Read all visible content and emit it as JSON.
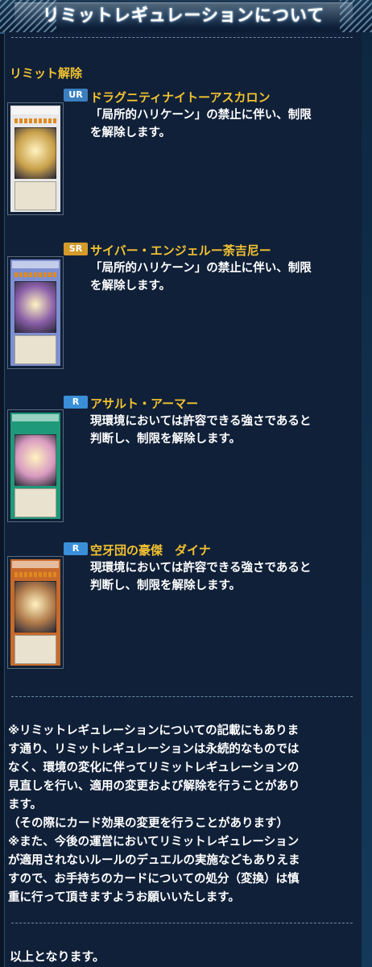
{
  "header": {
    "title": "リミットレギュレーションについて"
  },
  "section": {
    "title": "リミット解除"
  },
  "cards": [
    {
      "rarity": "UR",
      "rarity_color": "#3a7fbf",
      "name": "ドラグニティナイトーアスカロン",
      "desc_line1": "「局所的ハリケーン」の禁止に伴い、制限",
      "desc_line2": "を解除します。",
      "frame_color": "#e8e8ea",
      "art_color": "#c9a04a"
    },
    {
      "rarity": "SR",
      "rarity_color": "#d49a2a",
      "name": "サイバー・エンジェルー荼吉尼ー",
      "desc_line1": "「局所的ハリケーン」の禁止に伴い、制限",
      "desc_line2": "を解除します。",
      "frame_color": "#7d8fd0",
      "art_color": "#8a5fa8"
    },
    {
      "rarity": "R",
      "rarity_color": "#3a8fd8",
      "name": "アサルト・アーマー",
      "desc_line1": "現環境においては許容できる強さであると",
      "desc_line2": "判断し、制限を解除します。",
      "frame_color": "#1e9a7a",
      "art_color": "#d89ac0"
    },
    {
      "rarity": "R",
      "rarity_color": "#3a8fd8",
      "name": "空牙団の豪傑　ダイナ",
      "desc_line1": "現環境においては許容できる強さであると",
      "desc_line2": "判断し、制限を解除します。",
      "frame_color": "#c86a2a",
      "art_color": "#b07a4a"
    }
  ],
  "note": {
    "line1": "※リミットレギュレーションについての記載にもありま",
    "line2": "す通り、リミットレギュレーションは永続的なものでは",
    "line3": "なく、環境の変化に伴ってリミットレギュレーションの",
    "line4": "見直しを行い、適用の変更および解除を行うことがあり",
    "line5": "ます。",
    "line6": "（その際にカード効果の変更を行うことがあります）",
    "line7": "※また、今後の運営においてリミットレギュレーション",
    "line8": "が適用されないルールのデュエルの実施などもありえま",
    "line9": "すので、お手持ちのカードについての処分（変換）は慎",
    "line10": "重に行って頂きますようお願いいたします。"
  },
  "closing": {
    "text": "以上となります。"
  }
}
